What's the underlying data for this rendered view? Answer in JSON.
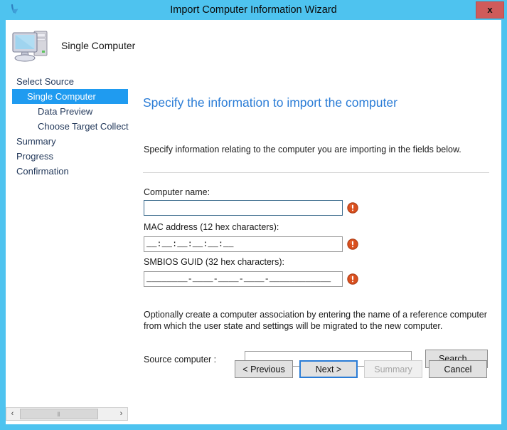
{
  "window": {
    "title": "Import Computer Information Wizard",
    "title_icon": "import-arrow-icon",
    "close_label": "x",
    "frame_color": "#4ec3ef",
    "titlebar_color": "#4ec3ef",
    "close_button_color": "#cf5b5b"
  },
  "header": {
    "icon": "computer-icon",
    "label": "Single Computer"
  },
  "nav": {
    "items": [
      {
        "label": "Select Source",
        "level": 0,
        "selected": false
      },
      {
        "label": "Single Computer",
        "level": 1,
        "selected": true
      },
      {
        "label": "Data Preview",
        "level": 2,
        "selected": false
      },
      {
        "label": "Choose Target Collect",
        "level": 2,
        "selected": false
      },
      {
        "label": "Summary",
        "level": 0,
        "selected": false
      },
      {
        "label": "Progress",
        "level": 0,
        "selected": false
      },
      {
        "label": "Confirmation",
        "level": 0,
        "selected": false
      }
    ],
    "selected_color": "#1f9bf0",
    "text_color": "#23395b"
  },
  "main": {
    "heading": "Specify the information to import the computer",
    "heading_color": "#2a7cd6",
    "intro": "Specify information relating to the computer you are importing in the fields below.",
    "fields": [
      {
        "label": "Computer name:",
        "value": "",
        "placeholder": "",
        "focused": true,
        "has_error": true,
        "error_icon": "error-icon"
      },
      {
        "label": "MAC address (12 hex characters):",
        "value": "__:__:__:__:__:__",
        "placeholder": "",
        "focused": false,
        "has_error": true,
        "error_icon": "error-icon"
      },
      {
        "label": "SMBIOS GUID (32 hex characters):",
        "value": "________-____-____-____-____________",
        "placeholder": "",
        "focused": false,
        "has_error": true,
        "error_icon": "error-icon"
      }
    ],
    "association_note": "Optionally create a computer association by entering the name of a reference computer from which the user state and settings will be migrated to the new computer.",
    "source_label": "Source computer :",
    "source_value": "",
    "source_placeholder": "",
    "search_label": "Search..."
  },
  "buttons": {
    "previous": "< Previous",
    "next": "Next >",
    "summary": "Summary",
    "cancel": "Cancel",
    "next_is_default": true,
    "summary_disabled": true
  },
  "scrollbar": {
    "left_arrow": "‹",
    "right_arrow": "›",
    "thumb_grip": "‖"
  }
}
